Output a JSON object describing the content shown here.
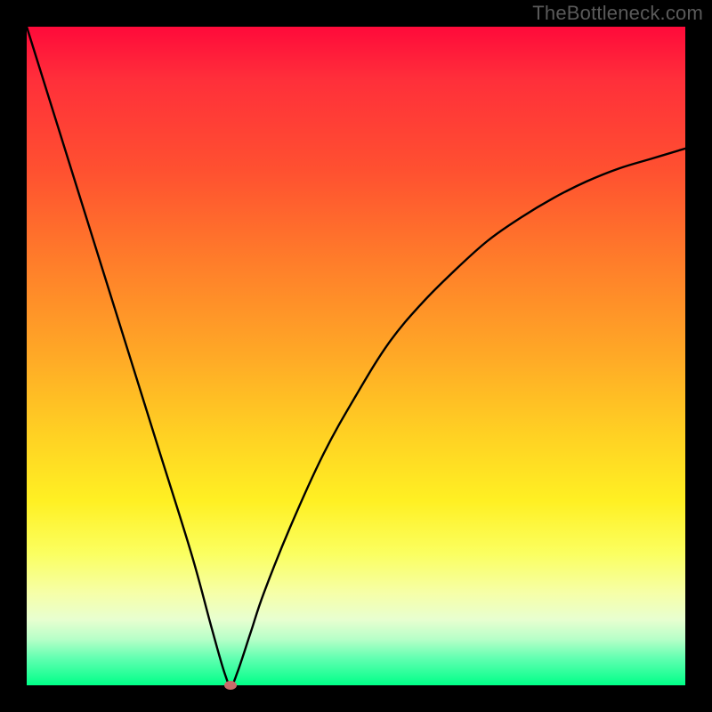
{
  "watermark": "TheBottleneck.com",
  "chart_data": {
    "type": "line",
    "title": "",
    "xlabel": "",
    "ylabel": "",
    "xlim": [
      0,
      100
    ],
    "ylim": [
      0,
      100
    ],
    "grid": false,
    "legend": false,
    "series": [
      {
        "name": "bottleneck-curve",
        "x": [
          0,
          5,
          10,
          15,
          20,
          25,
          28,
          30,
          31,
          32,
          34,
          36,
          40,
          45,
          50,
          55,
          60,
          65,
          70,
          75,
          80,
          85,
          90,
          95,
          100
        ],
        "values": [
          100,
          84,
          68,
          52,
          36,
          20,
          9,
          2,
          0,
          2,
          8,
          14,
          24,
          35,
          44,
          52,
          58,
          63,
          67.5,
          71,
          74,
          76.5,
          78.5,
          80,
          81.5
        ]
      }
    ],
    "annotations": [
      {
        "name": "minimum-marker",
        "x": 31,
        "y": 0,
        "color": "#c96a6a"
      }
    ],
    "background_gradient": {
      "top": "#ff0a3a",
      "mid": "#ffd123",
      "bottom": "#00ff88"
    }
  }
}
